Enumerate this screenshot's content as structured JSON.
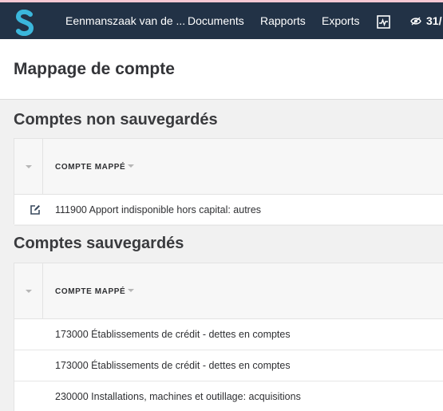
{
  "nav": {
    "company": "Eenmanszaak van de ...",
    "documents": "Documents",
    "rapports": "Rapports",
    "exports": "Exports",
    "count": "31/"
  },
  "icons": {
    "logo": "s-logo-icon",
    "activity": "activity-chart-icon",
    "visibility": "eye-icon",
    "edit": "edit-icon"
  },
  "colors": {
    "topbar": "#223246",
    "accent_strip": "#f6c8d3",
    "logo": "#3bb7dc"
  },
  "page": {
    "title": "Mappage de compte"
  },
  "unsaved": {
    "title": "Comptes non sauvegardés",
    "column": "COMPTE MAPPÉ",
    "rows": [
      "111900 Apport indisponible hors capital: autres"
    ]
  },
  "saved": {
    "title": "Comptes sauvegardés",
    "column": "COMPTE MAPPÉ",
    "rows": [
      "173000 Établissements de crédit - dettes en comptes",
      "173000 Établissements de crédit - dettes en comptes",
      "230000 Installations, machines et outillage: acquisitions"
    ]
  }
}
